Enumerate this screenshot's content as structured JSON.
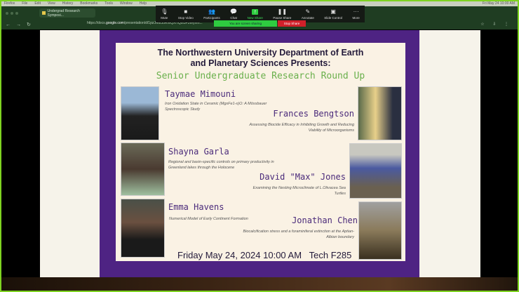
{
  "menubar": {
    "items": [
      "Firefox",
      "File",
      "Edit",
      "View",
      "History",
      "Bookmarks",
      "Tools",
      "Window",
      "Help"
    ],
    "status": "Fri May 24  10:00 AM"
  },
  "browser": {
    "tab_title": "Undergrad Research Symposi...",
    "url_prefix": "https://docs.",
    "url_domain": "google.com",
    "url_rest": "/presentation/d/1pzJAM5oRWQXHQsI5F5Wyhm..."
  },
  "zoom": {
    "buttons": [
      {
        "label": "Mute",
        "icon": "microphone-icon",
        "glyph": "🎙"
      },
      {
        "label": "Stop Video",
        "icon": "video-icon",
        "glyph": "■"
      },
      {
        "label": "Participants",
        "icon": "participants-icon",
        "glyph": "👥"
      },
      {
        "label": "Chat",
        "icon": "chat-icon",
        "glyph": "💬"
      },
      {
        "label": "New Share",
        "icon": "share-icon",
        "glyph": "↑"
      },
      {
        "label": "Pause Share",
        "icon": "pause-icon",
        "glyph": "❚❚"
      },
      {
        "label": "Annotate",
        "icon": "pencil-icon",
        "glyph": "✎"
      },
      {
        "label": "Slide Control",
        "icon": "slide-control-icon",
        "glyph": "▣"
      },
      {
        "label": "More",
        "icon": "more-icon",
        "glyph": "···"
      }
    ],
    "sharing_label": "You are screen sharing",
    "stop_label": "Stop Share"
  },
  "slide": {
    "title_line1": "The Northwestern University Department of Earth",
    "title_line2": "and Planetary Sciences Presents:",
    "subtitle": "Senior Undergraduate Research Round Up",
    "presenters": [
      {
        "name": "Taymae Mimouni",
        "topic": "Iron Oxidation State in Ceramic (MgxFe1-x)O: A Mössbauer Spectroscopic Study"
      },
      {
        "name": "Frances Bengtson",
        "topic": "Assessing Biocide Efficacy in Inhibiting Growth and Reducing Viability of Microorganisms"
      },
      {
        "name": "Shayna Garla",
        "topic": "Regional and basin-specific controls on primary productivity in Greenland lakes through the Holocene"
      },
      {
        "name": "David \"Max\" Jones",
        "topic": "Examining the Nesting Microclimate of L.Olivacea Sea Turtles"
      },
      {
        "name": "Emma Havens",
        "topic": "Numerical Model of Early Continent Formation"
      },
      {
        "name": "Jonathan Chen",
        "topic": "Biocalcification stress and a foraminiferal extinction at the Aptian-Albian boundary"
      }
    ],
    "footer": "Friday May 24, 2024 10:00 AM   Tech F285"
  },
  "colors": {
    "share_border": "#7ed321",
    "slide_purple": "#4e2383",
    "subtitle_green": "#6ab04c",
    "name_purple": "#4a2a7a"
  }
}
